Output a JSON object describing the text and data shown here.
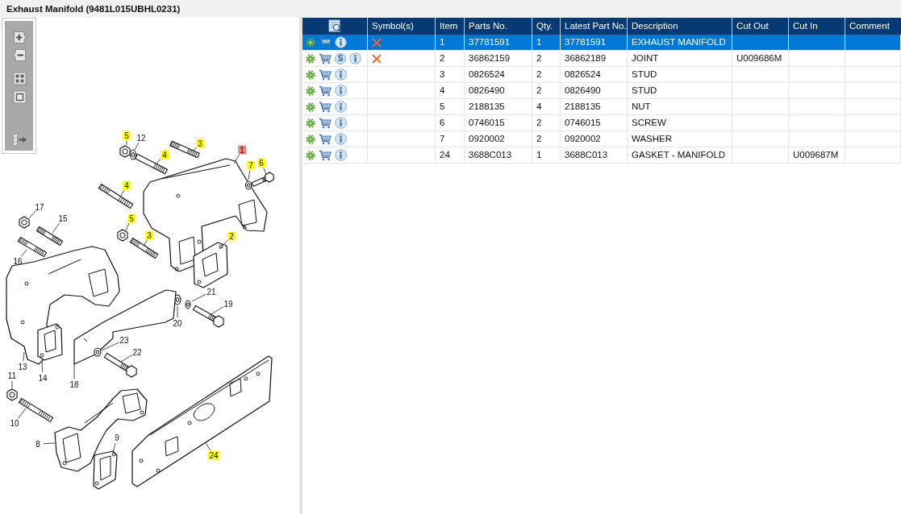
{
  "title": "Exhaust Manifold (9481L015UBHL0231)",
  "diagram": {
    "callouts": [
      {
        "label": "5",
        "linked": true,
        "selected": false
      },
      {
        "label": "12",
        "linked": false,
        "selected": false
      },
      {
        "label": "4",
        "linked": true,
        "selected": false
      },
      {
        "label": "3",
        "linked": true,
        "selected": false
      },
      {
        "label": "1",
        "linked": true,
        "selected": true
      },
      {
        "label": "7",
        "linked": true,
        "selected": false
      },
      {
        "label": "6",
        "linked": true,
        "selected": false
      },
      {
        "label": "4",
        "linked": true,
        "selected": false
      },
      {
        "label": "17",
        "linked": false,
        "selected": false
      },
      {
        "label": "15",
        "linked": false,
        "selected": false
      },
      {
        "label": "5",
        "linked": true,
        "selected": false
      },
      {
        "label": "3",
        "linked": true,
        "selected": false
      },
      {
        "label": "2",
        "linked": true,
        "selected": false
      },
      {
        "label": "16",
        "linked": false,
        "selected": false
      },
      {
        "label": "21",
        "linked": false,
        "selected": false
      },
      {
        "label": "19",
        "linked": false,
        "selected": false
      },
      {
        "label": "20",
        "linked": false,
        "selected": false
      },
      {
        "label": "23",
        "linked": false,
        "selected": false
      },
      {
        "label": "22",
        "linked": false,
        "selected": false
      },
      {
        "label": "13",
        "linked": false,
        "selected": false
      },
      {
        "label": "14",
        "linked": false,
        "selected": false
      },
      {
        "label": "18",
        "linked": false,
        "selected": false
      },
      {
        "label": "11",
        "linked": false,
        "selected": false
      },
      {
        "label": "10",
        "linked": false,
        "selected": false
      },
      {
        "label": "8",
        "linked": false,
        "selected": false
      },
      {
        "label": "9",
        "linked": false,
        "selected": false
      },
      {
        "label": "24",
        "linked": true,
        "selected": false
      }
    ]
  },
  "table": {
    "columns": [
      "Symbol(s)",
      "Item",
      "Parts No.",
      "Qty.",
      "Latest Part No.",
      "Description",
      "Cut Out",
      "Cut In",
      "Comment"
    ],
    "rows": [
      {
        "selected": true,
        "cross_symbol": true,
        "item": "1",
        "parts_no": "37781591",
        "qty": "1",
        "latest_part_no": "37781591",
        "description": "EXHAUST MANIFOLD"
      },
      {
        "selected": false,
        "cross_symbol": true,
        "badge": "S",
        "item": "2",
        "parts_no": "36862159",
        "qty": "2",
        "latest_part_no": "36862189",
        "description": "JOINT",
        "cut_out": "U009686M"
      },
      {
        "selected": false,
        "cross_symbol": false,
        "item": "3",
        "parts_no": "0826524",
        "qty": "2",
        "latest_part_no": "0826524",
        "description": "STUD"
      },
      {
        "selected": false,
        "cross_symbol": false,
        "item": "4",
        "parts_no": "0826490",
        "qty": "2",
        "latest_part_no": "0826490",
        "description": "STUD"
      },
      {
        "selected": false,
        "cross_symbol": false,
        "item": "5",
        "parts_no": "2188135",
        "qty": "4",
        "latest_part_no": "2188135",
        "description": "NUT"
      },
      {
        "selected": false,
        "cross_symbol": false,
        "item": "6",
        "parts_no": "0746015",
        "qty": "2",
        "latest_part_no": "0746015",
        "description": "SCREW"
      },
      {
        "selected": false,
        "cross_symbol": false,
        "item": "7",
        "parts_no": "0920002",
        "qty": "2",
        "latest_part_no": "0920002",
        "description": "WASHER"
      },
      {
        "selected": false,
        "cross_symbol": false,
        "item": "24",
        "parts_no": "3688C013",
        "qty": "1",
        "latest_part_no": "3688C013",
        "description": "GASKET - MANIFOLD",
        "cut_in": "U009687M"
      }
    ]
  }
}
